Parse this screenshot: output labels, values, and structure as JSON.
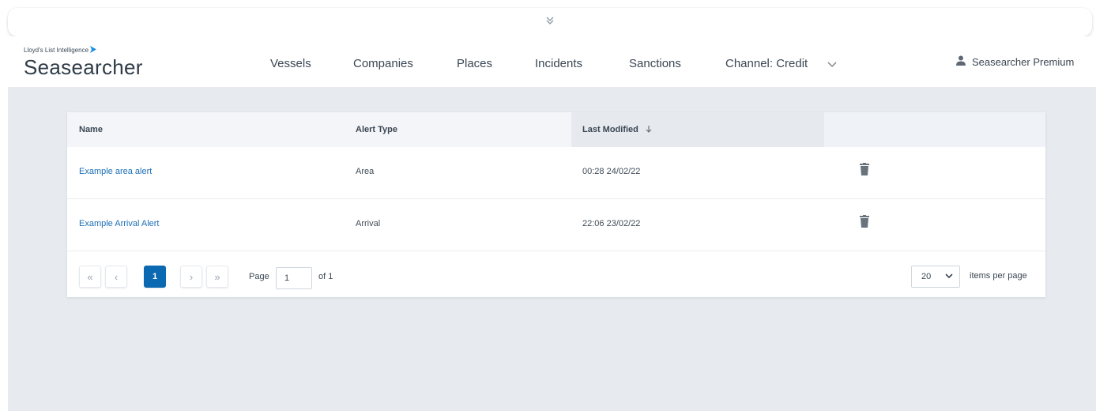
{
  "brand": {
    "company": "Lloyd's List Intelligence",
    "product": "Seasearcher"
  },
  "nav": {
    "items": [
      "Vessels",
      "Companies",
      "Places",
      "Incidents",
      "Sanctions",
      "Channel: Credit"
    ]
  },
  "user": {
    "name": "Seasearcher Premium"
  },
  "table": {
    "columns": {
      "name": "Name",
      "alert_type": "Alert Type",
      "last_modified": "Last Modified"
    },
    "sort_column": "last_modified",
    "rows": [
      {
        "name": "Example area alert",
        "alert_type": "Area",
        "last_modified": "00:28  24/02/22"
      },
      {
        "name": "Example Arrival Alert",
        "alert_type": "Arrival",
        "last_modified": "22:06  23/02/22"
      }
    ]
  },
  "pagination": {
    "first": "«",
    "prev": "‹",
    "current": "1",
    "next": "›",
    "last": "»",
    "page_label": "Page",
    "page_value": "1",
    "of_label": "of 1",
    "per_page_value": "20",
    "per_page_label": "items per page"
  },
  "colors": {
    "accent": "#0a69b0",
    "link": "#1d6fb5",
    "background": "#e7ebf0"
  }
}
